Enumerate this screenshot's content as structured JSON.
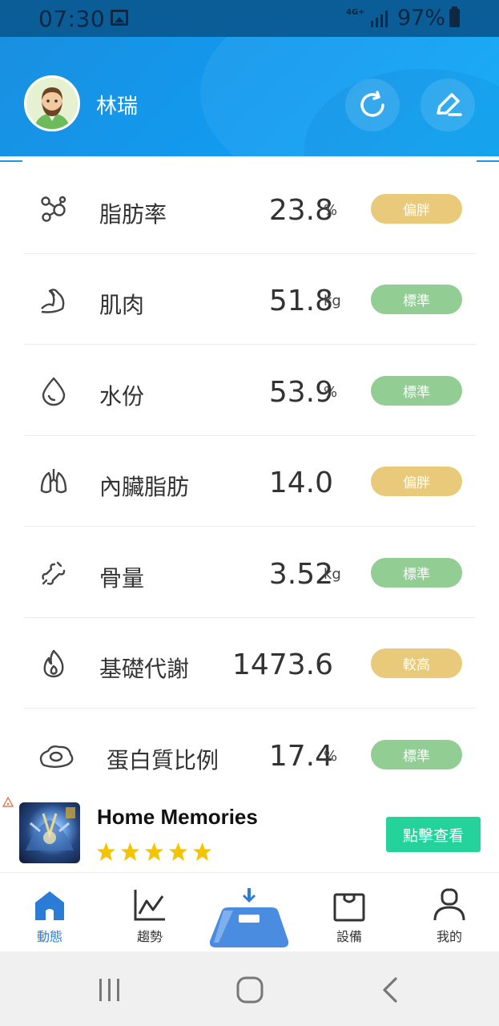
{
  "status_bar": {
    "time": "07:30",
    "network": "4G+",
    "battery": "97%"
  },
  "header": {
    "user_name": "林瑞",
    "sync_icon": "sync-icon",
    "edit_icon": "edit-pencil-icon"
  },
  "metrics": [
    {
      "label": "脂肪率",
      "value": "23.8",
      "unit": "%",
      "badge": "偏胖",
      "badge_color": "#e8ca7a",
      "icon": "fat-molecule-icon"
    },
    {
      "label": "肌肉",
      "value": "51.8",
      "unit": "kg",
      "badge": "標準",
      "badge_color": "#92cd93",
      "icon": "muscle-arm-icon"
    },
    {
      "label": "水份",
      "value": "53.9",
      "unit": "%",
      "badge": "標準",
      "badge_color": "#92cd93",
      "icon": "water-drop-icon"
    },
    {
      "label": "內臟脂肪",
      "value": "14.0",
      "unit": "",
      "badge": "偏胖",
      "badge_color": "#e8ca7a",
      "icon": "lungs-icon"
    },
    {
      "label": "骨量",
      "value": "3.52",
      "unit": "kg",
      "badge": "標準",
      "badge_color": "#92cd93",
      "icon": "bone-icon"
    },
    {
      "label": "基礎代謝",
      "value": "1473.6",
      "unit": "",
      "badge": "較高",
      "badge_color": "#e8ca7a",
      "icon": "flame-icon"
    },
    {
      "label": "蛋白質比例",
      "value": "17.4",
      "unit": "%",
      "badge": "標準",
      "badge_color": "#92cd93",
      "icon": "egg-icon"
    }
  ],
  "ad": {
    "title": "Home Memories",
    "rating_stars": 5,
    "button_label": "點擊查看",
    "button_color": "#23d39a"
  },
  "bottom_nav": {
    "items": [
      {
        "label": "動態",
        "icon": "home-icon",
        "active": true
      },
      {
        "label": "趨勢",
        "icon": "trend-chart-icon",
        "active": false
      },
      {
        "label": "設備",
        "icon": "shopping-bag-icon",
        "active": false
      },
      {
        "label": "我的",
        "icon": "user-icon",
        "active": false
      }
    ],
    "center_icon": "scale-weigh-icon"
  },
  "colors": {
    "accent": "#2b7cd6",
    "header_blue": "#119bf0",
    "status_bar": "#0a5d96"
  }
}
